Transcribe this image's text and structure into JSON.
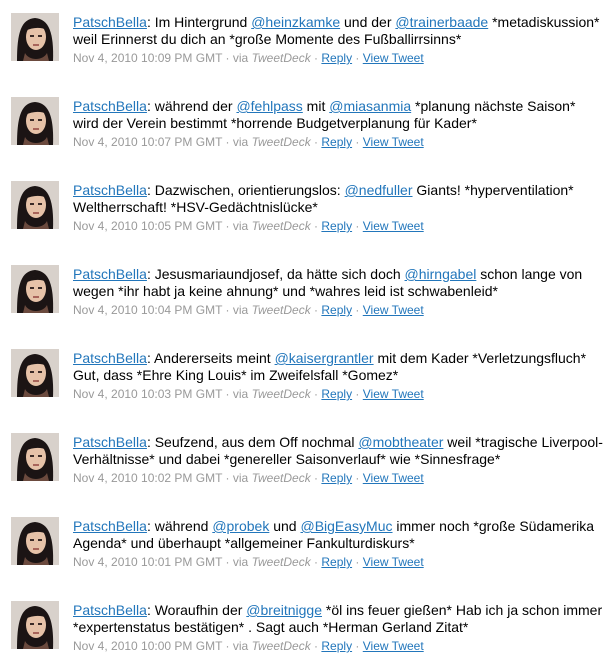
{
  "tweets": [
    {
      "segments": [
        {
          "text": "PatschBella",
          "link": true
        },
        {
          "text": ": Im Hintergrund ",
          "link": false
        },
        {
          "text": "@heinzkamke",
          "link": true
        },
        {
          "text": " und der ",
          "link": false
        },
        {
          "text": "@trainerbaade",
          "link": true
        },
        {
          "text": " *metadiskussion* weil Erinnerst du dich an *große Momente des Fußballirrsinns*",
          "link": false
        }
      ],
      "timestamp": "Nov 4, 2010 10:09 PM GMT",
      "via": "via",
      "source": "TweetDeck",
      "reply": "Reply",
      "view": "View Tweet"
    },
    {
      "segments": [
        {
          "text": "PatschBella",
          "link": true
        },
        {
          "text": ": während der ",
          "link": false
        },
        {
          "text": "@fehlpass",
          "link": true
        },
        {
          "text": " mit ",
          "link": false
        },
        {
          "text": "@miasanmia",
          "link": true
        },
        {
          "text": " *planung nächste Saison* wird der Verein bestimmt *horrende Budgetverplanung für Kader*",
          "link": false
        }
      ],
      "timestamp": "Nov 4, 2010 10:07 PM GMT",
      "via": "via",
      "source": "TweetDeck",
      "reply": "Reply",
      "view": "View Tweet"
    },
    {
      "segments": [
        {
          "text": "PatschBella",
          "link": true
        },
        {
          "text": ": Dazwischen, orientierungslos: ",
          "link": false
        },
        {
          "text": "@nedfuller",
          "link": true
        },
        {
          "text": " Giants! *hyperventilation* Weltherrschaft! *HSV-Gedächtnislücke*",
          "link": false
        }
      ],
      "timestamp": "Nov 4, 2010 10:05 PM GMT",
      "via": "via",
      "source": "TweetDeck",
      "reply": "Reply",
      "view": "View Tweet"
    },
    {
      "segments": [
        {
          "text": "PatschBella",
          "link": true
        },
        {
          "text": ": Jesusmariaundjosef, da hätte sich doch ",
          "link": false
        },
        {
          "text": "@hirngabel",
          "link": true
        },
        {
          "text": " schon lange von wegen *ihr habt ja keine ahnung* und *wahres leid ist schwabenleid*",
          "link": false
        }
      ],
      "timestamp": "Nov 4, 2010 10:04 PM GMT",
      "via": "via",
      "source": "TweetDeck",
      "reply": "Reply",
      "view": "View Tweet"
    },
    {
      "segments": [
        {
          "text": "PatschBella",
          "link": true
        },
        {
          "text": ": Andererseits meint ",
          "link": false
        },
        {
          "text": "@kaisergrantler",
          "link": true
        },
        {
          "text": " mit dem Kader *Verletzungsfluch* Gut, dass *Ehre King Louis* im Zweifelsfall *Gomez*",
          "link": false
        }
      ],
      "timestamp": "Nov 4, 2010 10:03 PM GMT",
      "via": "via",
      "source": "TweetDeck",
      "reply": "Reply",
      "view": "View Tweet"
    },
    {
      "segments": [
        {
          "text": "PatschBella",
          "link": true
        },
        {
          "text": ": Seufzend, aus dem Off nochmal ",
          "link": false
        },
        {
          "text": "@mobtheater",
          "link": true
        },
        {
          "text": " weil *tragische Liverpool-Verhältnisse* und dabei *genereller Saisonverlauf* wie *Sinnesfrage*",
          "link": false
        }
      ],
      "timestamp": "Nov 4, 2010 10:02 PM GMT",
      "via": "via",
      "source": "TweetDeck",
      "reply": "Reply",
      "view": "View Tweet"
    },
    {
      "segments": [
        {
          "text": "PatschBella",
          "link": true
        },
        {
          "text": ": während ",
          "link": false
        },
        {
          "text": "@probek",
          "link": true
        },
        {
          "text": " und ",
          "link": false
        },
        {
          "text": "@BigEasyMuc",
          "link": true
        },
        {
          "text": " immer noch *große Südamerika Agenda* und überhaupt *allgemeiner Fankulturdiskurs*",
          "link": false
        }
      ],
      "timestamp": "Nov 4, 2010 10:01 PM GMT",
      "via": "via",
      "source": "TweetDeck",
      "reply": "Reply",
      "view": "View Tweet"
    },
    {
      "segments": [
        {
          "text": "PatschBella",
          "link": true
        },
        {
          "text": ": Woraufhin der ",
          "link": false
        },
        {
          "text": "@breitnigge",
          "link": true
        },
        {
          "text": " *öl ins feuer gießen* Hab ich ja schon immer *expertenstatus bestätigen* . Sagt auch *Herman Gerland Zitat*",
          "link": false
        }
      ],
      "timestamp": "Nov 4, 2010 10:00 PM GMT",
      "via": "via",
      "source": "TweetDeck",
      "reply": "Reply",
      "view": "View Tweet"
    }
  ]
}
